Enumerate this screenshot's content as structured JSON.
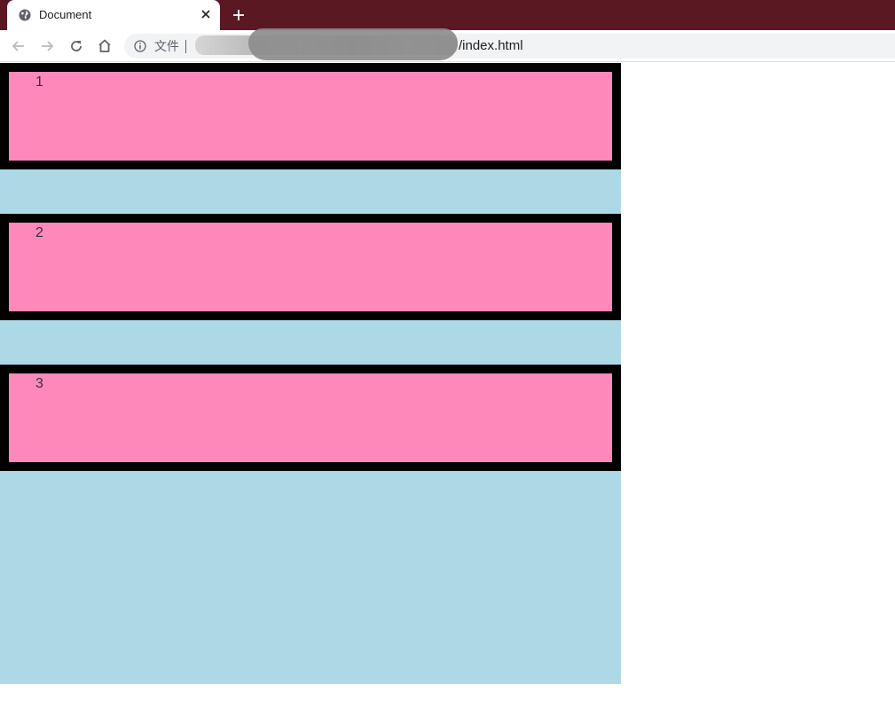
{
  "browser": {
    "tab": {
      "title": "Document",
      "favicon": "globe-icon"
    },
    "toolbar": {
      "security_label": "文件",
      "url_visible_suffix": "/index.html"
    },
    "colors": {
      "tabstrip": "#5a1822",
      "omnibox": "#f1f3f4"
    }
  },
  "page": {
    "colors": {
      "container_background": "#add8e6",
      "box_background": "#ff88bb",
      "box_border": "#000000"
    },
    "boxes": [
      {
        "label": "1"
      },
      {
        "label": "2"
      },
      {
        "label": "3"
      }
    ]
  }
}
